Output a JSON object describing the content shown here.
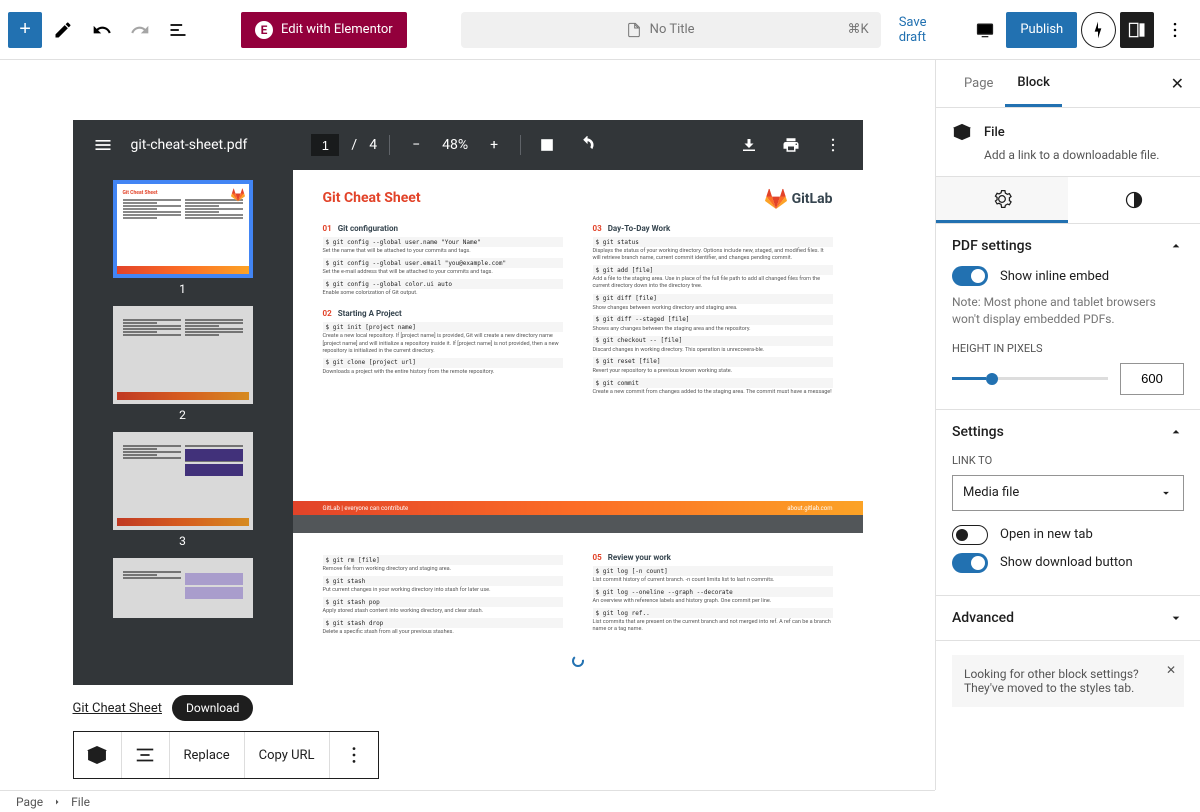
{
  "toolbar": {
    "elementor_label": "Edit with Elementor",
    "title": "No Title",
    "shortcut": "⌘K",
    "save_draft": "Save draft",
    "publish": "Publish"
  },
  "pdf": {
    "filename": "git-cheat-sheet.pdf",
    "current_page": "1",
    "page_sep": "/",
    "total_pages": "4",
    "zoom": "48%",
    "thumb_labels": [
      "1",
      "2",
      "3"
    ],
    "doc_title": "Git Cheat Sheet",
    "brand": "GitLab",
    "footer_left": "GitLab | everyone can contribute",
    "footer_right": "about.gitlab.com",
    "sections": [
      {
        "num": "01",
        "title": "Git configuration",
        "items": [
          {
            "cmd": "$ git config --global user.name \"Your Name\"",
            "desc": "Set the name that will be attached to your commits and tags."
          },
          {
            "cmd": "$ git config --global user.email \"you@example.com\"",
            "desc": "Set the e-mail address that will be attached to your commits and tags."
          },
          {
            "cmd": "$ git config --global color.ui auto",
            "desc": "Enable some colorization of Git output."
          }
        ]
      },
      {
        "num": "02",
        "title": "Starting A Project",
        "items": [
          {
            "cmd": "$ git init [project name]",
            "desc": "Create a new local repository. If [project name] is provided, Git will create a new directory name [project name] and will initialize a repository inside it. If [project name] is not provided, then a new repository is initialized in the current directory."
          },
          {
            "cmd": "$ git clone [project url]",
            "desc": "Downloads a project with the entire history from the remote repository."
          }
        ]
      },
      {
        "num": "03",
        "title": "Day-To-Day Work",
        "items": [
          {
            "cmd": "$ git status",
            "desc": "Displays the status of your working directory. Options include new, staged, and modified files. It will retrieve branch name, current commit identifier, and changes pending commit."
          },
          {
            "cmd": "$ git add [file]",
            "desc": "Add a file to the staging area. Use in place of the full file path to add all changed files from the current directory down into the directory tree."
          },
          {
            "cmd": "$ git diff [file]",
            "desc": "Show changes between working directory and staging area."
          },
          {
            "cmd": "$ git diff --staged [file]",
            "desc": "Shows any changes between the staging area and the repository."
          },
          {
            "cmd": "$ git checkout -- [file]",
            "desc": "Discard changes in working directory. This operation is unrecovera-ble."
          },
          {
            "cmd": "$ git reset [file]",
            "desc": "Revert your repository to a previous known working state."
          },
          {
            "cmd": "$ git commit",
            "desc": "Create a new commit from changes added to the staging area. The commit must have a message!"
          }
        ]
      }
    ],
    "page2_left": [
      {
        "cmd": "$ git rm [file]",
        "desc": "Remove file from working directory and staging area."
      },
      {
        "cmd": "$ git stash",
        "desc": "Put current changes in your working directory into stash for later use."
      },
      {
        "cmd": "$ git stash pop",
        "desc": "Apply stored stash content into working directory, and clear stash."
      },
      {
        "cmd": "$ git stash drop",
        "desc": "Delete a specific stash from all your previous stashes."
      }
    ],
    "page2_right": {
      "num": "05",
      "title": "Review your work",
      "items": [
        {
          "cmd": "$ git log [-n count]",
          "desc": "List commit history of current branch. -n count limits list to last n commits."
        },
        {
          "cmd": "$ git log --oneline --graph --decorate",
          "desc": "An overview with reference labels and history graph. One commit per line."
        },
        {
          "cmd": "$ git log ref..",
          "desc": "List commits that are present on the current branch and not merged into ref. A ref can be a branch name or a tag name."
        }
      ]
    }
  },
  "file_block": {
    "link_text": "Git Cheat Sheet",
    "download": "Download",
    "replace": "Replace",
    "copy_url": "Copy URL"
  },
  "sidebar": {
    "tab_page": "Page",
    "tab_block": "Block",
    "block_type": "File",
    "block_desc": "Add a link to a downloadable file.",
    "panel_pdf": "PDF settings",
    "show_inline": "Show inline embed",
    "note": "Note: Most phone and tablet browsers won't display embedded PDFs.",
    "height_label": "HEIGHT IN PIXELS",
    "height_value": "600",
    "panel_settings": "Settings",
    "link_to_label": "LINK TO",
    "link_to_value": "Media file",
    "open_new_tab": "Open in new tab",
    "show_download": "Show download button",
    "panel_advanced": "Advanced",
    "notice": "Looking for other block settings? They've moved to the styles tab."
  },
  "breadcrumb": {
    "root": "Page",
    "current": "File"
  }
}
